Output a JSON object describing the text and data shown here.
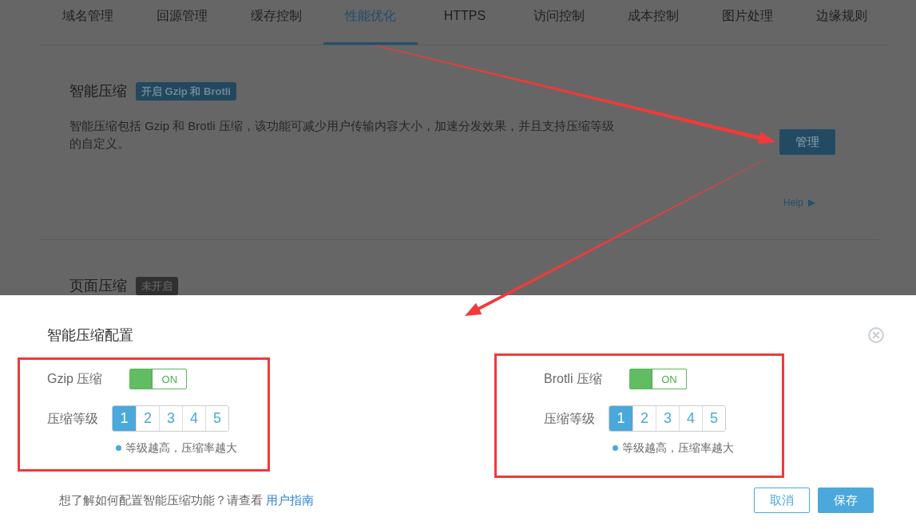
{
  "tabs": [
    {
      "label": "域名管理",
      "selected": false
    },
    {
      "label": "回源管理",
      "selected": false
    },
    {
      "label": "缓存控制",
      "selected": false
    },
    {
      "label": "性能优化",
      "selected": true
    },
    {
      "label": "HTTPS",
      "selected": false
    },
    {
      "label": "访问控制",
      "selected": false
    },
    {
      "label": "成本控制",
      "selected": false
    },
    {
      "label": "图片处理",
      "selected": false
    },
    {
      "label": "边缘规则",
      "selected": false
    }
  ],
  "sections": [
    {
      "title": "智能压缩",
      "badge": {
        "text": "开启 Gzip 和 Brotli",
        "kind": "enabled"
      },
      "description": "智能压缩包括 Gzip 和 Brotli 压缩，该功能可减少用户传输内容大小，加速分发效果，并且支持压缩等级的自定义。",
      "button": "管理",
      "help": "Help"
    },
    {
      "title": "页面压缩",
      "badge": {
        "text": "未开启",
        "kind": "disabled"
      }
    }
  ],
  "dialog": {
    "title": "智能压缩配置",
    "groups": [
      {
        "label": "Gzip 压缩",
        "highlighted": true,
        "toggle": {
          "on": true,
          "text": "ON"
        },
        "level_label": "压缩等级",
        "levels": [
          {
            "label": "1",
            "selected": true
          },
          {
            "label": "2",
            "selected": false
          },
          {
            "label": "3",
            "selected": false
          },
          {
            "label": "4",
            "selected": false
          },
          {
            "label": "5",
            "selected": false
          }
        ],
        "hint": "等级越高，压缩率越大"
      },
      {
        "label": "Brotli 压缩",
        "highlighted": true,
        "toggle": {
          "on": true,
          "text": "ON"
        },
        "level_label": "压缩等级",
        "levels": [
          {
            "label": "1",
            "selected": true
          },
          {
            "label": "2",
            "selected": false
          },
          {
            "label": "3",
            "selected": false
          },
          {
            "label": "4",
            "selected": false
          },
          {
            "label": "5",
            "selected": false
          }
        ],
        "hint": "等级越高，压缩率越大"
      }
    ],
    "footer": {
      "text": "想了解如何配置智能压缩功能？请查看",
      "link": "用户指南"
    },
    "buttons": [
      {
        "label": "取消",
        "kind": "secondary"
      },
      {
        "label": "保存",
        "kind": "primary"
      }
    ]
  }
}
